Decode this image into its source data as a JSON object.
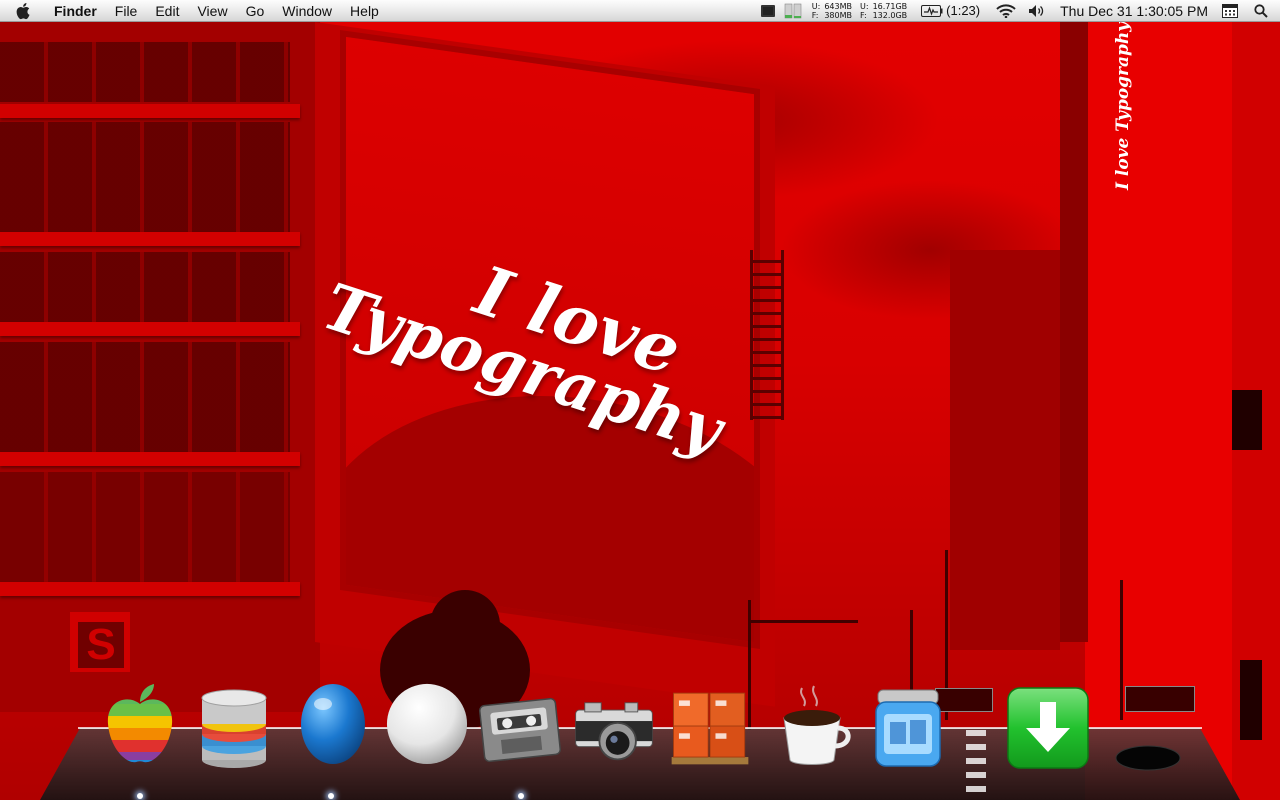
{
  "menubar": {
    "app_name": "Finder",
    "menus": [
      "File",
      "Edit",
      "View",
      "Go",
      "Window",
      "Help"
    ],
    "memory": {
      "used_label": "U:",
      "free_label": "F:",
      "ram_used": "643MB",
      "ram_free": "380MB",
      "disk_used": "16.71GB",
      "disk_free": "132.0GB"
    },
    "battery_time": "(1:23)",
    "clock": "Thu Dec 31  1:30:05 PM"
  },
  "wallpaper": {
    "billboard_line1": "I love",
    "billboard_line2": "Typography",
    "vertical_text": "I love Typography"
  },
  "dock": {
    "items": [
      {
        "icon": "rainbow-apple-icon"
      },
      {
        "icon": "database-stack-icon"
      },
      {
        "icon": "blue-egg-icon"
      },
      {
        "icon": "white-orb-icon"
      },
      {
        "icon": "cassette-tape-icon"
      },
      {
        "icon": "camera-icon"
      },
      {
        "icon": "shipping-boxes-icon"
      },
      {
        "icon": "coffee-cup-icon"
      },
      {
        "icon": "blue-jar-icon"
      },
      {
        "icon": "download-arrow-icon"
      },
      {
        "icon": "trash-hole-icon"
      }
    ]
  },
  "colors": {
    "wallpaper_red": "#e30000",
    "menubar_bg": "#ececec",
    "download_green": "#22c22e"
  }
}
